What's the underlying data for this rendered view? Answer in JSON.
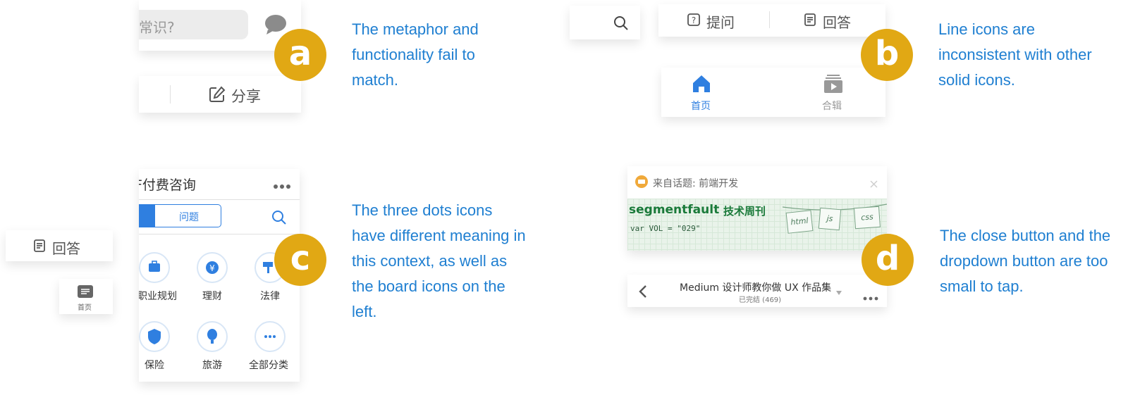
{
  "panel_a": {
    "search_fragment": "常识?",
    "share_label": "分享",
    "badge": "a",
    "description": "The metaphor and functionality fail to match."
  },
  "panel_b": {
    "ask_label": "提问",
    "answer_label": "回答",
    "home_label": "首页",
    "collection_label": "合辑",
    "badge": "b",
    "description": "Line icons are inconsistent with other solid icons."
  },
  "panel_c": {
    "title": "F付费咨询",
    "tab_label": "问题",
    "categories": [
      "职业规划",
      "理财",
      "法律",
      "保险",
      "旅游",
      "全部分类"
    ],
    "side_answer_label": "回答",
    "side_home_label": "首页",
    "badge": "c",
    "description": "The three dots icons have different meaning in this context, as well as the board icons on the left."
  },
  "panel_d": {
    "topic_label": "来自话题: 前端开发",
    "banner_brand": "segmentfault",
    "banner_title": "技术周刊",
    "banner_code": "var VOL = \"029\"",
    "banner_tags": [
      "html",
      "js",
      "css"
    ],
    "collection_title": "Medium 设计师教你做 UX 作品集",
    "collection_status": "已完结 (469)",
    "badge": "d",
    "description": "The close button and the dropdown button are too small to tap."
  },
  "colors": {
    "badge": "#e1a814",
    "description": "#1f7fd1",
    "icon_blue": "#2f7fe0",
    "icon_gray": "#888888"
  }
}
